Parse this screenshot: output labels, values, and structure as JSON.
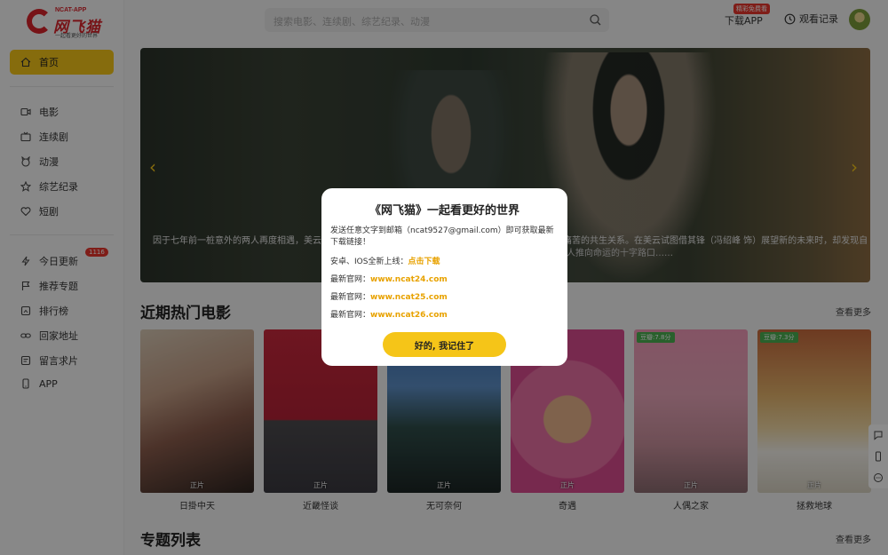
{
  "logo": {
    "tag": "NCAT-APP",
    "name": "网飞猫",
    "slogan": "一起看更好的世界"
  },
  "sidebar": {
    "items": [
      {
        "label": "首页",
        "icon": "home-icon"
      },
      {
        "label": "电影",
        "icon": "film-icon"
      },
      {
        "label": "连续剧",
        "icon": "tv-icon"
      },
      {
        "label": "动漫",
        "icon": "anime-icon"
      },
      {
        "label": "综艺纪录",
        "icon": "star-icon"
      },
      {
        "label": "短剧",
        "icon": "heart-icon"
      },
      {
        "label": "今日更新",
        "icon": "lightning-icon"
      },
      {
        "label": "推荐专题",
        "icon": "flag-icon"
      },
      {
        "label": "排行榜",
        "icon": "ranking-icon"
      },
      {
        "label": "回家地址",
        "icon": "link-icon"
      },
      {
        "label": "留言求片",
        "icon": "message-icon"
      },
      {
        "label": "APP",
        "icon": "phone-icon"
      }
    ],
    "update_badge": "1116"
  },
  "header": {
    "search_placeholder": "搜索电影、连续剧、综艺纪录、动漫",
    "download_label": "下载APP",
    "download_badge": "精彩免费看",
    "history_label": "观看记录"
  },
  "banner": {
    "caption_left": "因于七年前一桩意外的两人再度相遇，美云",
    "caption_right": "痛苦的共生关系。在美云试图借其锋（冯绍峰 饰）展望新的未来时，却发现自",
    "caption_right2": "人推向命运的十字路口……"
  },
  "sections": {
    "hot_movies": {
      "title": "近期热门电影",
      "more": "查看更多"
    },
    "topics": {
      "title": "专题列表",
      "more": "查看更多"
    }
  },
  "movies": [
    {
      "title": "日掛中天",
      "tag": "正片",
      "score": ""
    },
    {
      "title": "近畿怪谈",
      "tag": "正片",
      "score": ""
    },
    {
      "title": "无可奈何",
      "tag": "正片",
      "score": ""
    },
    {
      "title": "奇遇",
      "tag": "正片",
      "score": ""
    },
    {
      "title": "人偶之家",
      "tag": "正片",
      "score": "豆瓣:7.8分"
    },
    {
      "title": "拯救地球",
      "tag": "正片",
      "score": "豆瓣:7.3分"
    }
  ],
  "modal": {
    "title": "《网飞猫》一起看更好的世界",
    "line1": "发送任意文字到邮箱（ncat9527@gmail.com）即可获取最新下载链接！",
    "line2_prefix": "安卓、IOS全新上线：",
    "line2_link": "点击下载",
    "site_prefix": "最新官网：",
    "site1": "www.ncat24.com",
    "site2": "www.ncat25.com",
    "site3": "www.ncat26.com",
    "confirm": "好的, 我记住了"
  },
  "colors": {
    "accent": "#f5c518",
    "brand": "#d9232b"
  }
}
